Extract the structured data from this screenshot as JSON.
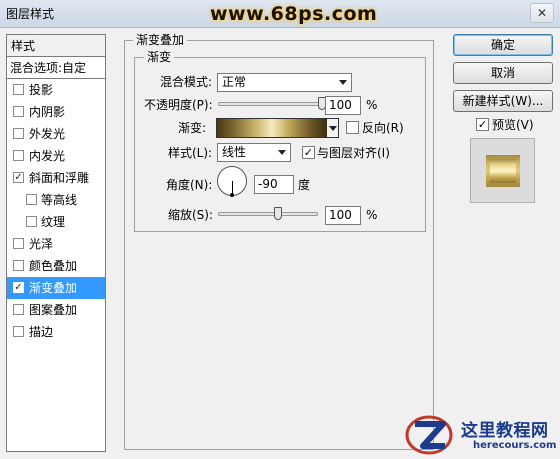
{
  "window": {
    "title": "图层样式",
    "watermark": "www.68ps.com",
    "close": "✕"
  },
  "sidebar": {
    "header": "样式",
    "blend_options": "混合选项:自定",
    "items": [
      {
        "label": "投影",
        "checked": false,
        "selected": false,
        "sub": false
      },
      {
        "label": "内阴影",
        "checked": false,
        "selected": false,
        "sub": false
      },
      {
        "label": "外发光",
        "checked": false,
        "selected": false,
        "sub": false
      },
      {
        "label": "内发光",
        "checked": false,
        "selected": false,
        "sub": false
      },
      {
        "label": "斜面和浮雕",
        "checked": true,
        "selected": false,
        "sub": false
      },
      {
        "label": "等高线",
        "checked": false,
        "selected": false,
        "sub": true
      },
      {
        "label": "纹理",
        "checked": false,
        "selected": false,
        "sub": true
      },
      {
        "label": "光泽",
        "checked": false,
        "selected": false,
        "sub": false
      },
      {
        "label": "颜色叠加",
        "checked": false,
        "selected": false,
        "sub": false
      },
      {
        "label": "渐变叠加",
        "checked": true,
        "selected": true,
        "sub": false
      },
      {
        "label": "图案叠加",
        "checked": false,
        "selected": false,
        "sub": false
      },
      {
        "label": "描边",
        "checked": false,
        "selected": false,
        "sub": false
      }
    ]
  },
  "panel": {
    "group_title": "渐变叠加",
    "sub_group_title": "渐变",
    "blend_mode_label": "混合模式:",
    "blend_mode_value": "正常",
    "opacity_label": "不透明度(P):",
    "opacity_value": "100",
    "opacity_unit": "%",
    "opacity_fraction": 1.0,
    "gradient_label": "渐变:",
    "reverse_label": "反向(R)",
    "reverse_checked": false,
    "style_label": "样式(L):",
    "style_value": "线性",
    "align_label": "与图层对齐(I)",
    "align_checked": true,
    "angle_label": "角度(N):",
    "angle_value": "-90",
    "angle_unit": "度",
    "scale_label": "缩放(S):",
    "scale_value": "100",
    "scale_unit": "%",
    "scale_fraction": 0.6
  },
  "buttons": {
    "ok": "确定",
    "cancel": "取消",
    "new_style": "新建样式(W)...",
    "preview_label": "预览(V)",
    "preview_checked": true
  },
  "logo": {
    "cn": "这里教程网",
    "en": "herecours.com"
  },
  "icons": {
    "check": "✓"
  }
}
